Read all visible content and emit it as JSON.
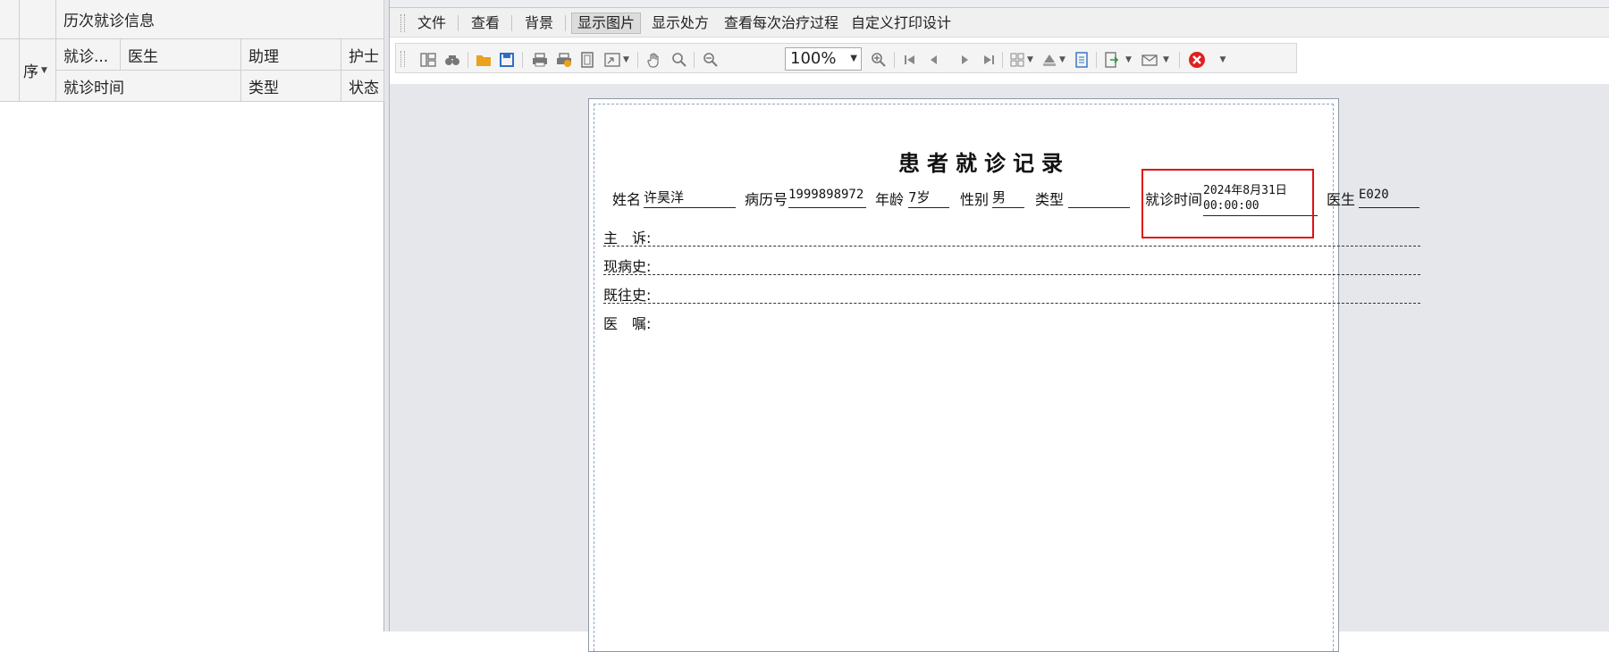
{
  "left_panel": {
    "group_header": "历次就诊信息",
    "columns_row1": [
      "就诊...",
      "医生",
      "助理",
      "护士"
    ],
    "columns_row2": [
      "就诊时间",
      "类型",
      "状态"
    ],
    "seq_column": "序",
    "seq_filter_icon": "dropdown-arrow"
  },
  "menu": {
    "items": [
      "文件",
      "查看",
      "背景",
      "显示图片",
      "显示处方",
      "查看每次治疗过程",
      "自定义打印设计"
    ],
    "active_item": "显示图片"
  },
  "toolbar": {
    "zoom_value": "100%",
    "icons": [
      "toc-icon",
      "find-icon",
      "open-icon",
      "save-icon",
      "print-icon",
      "quick-print-icon",
      "page-setup-icon",
      "scale-icon",
      "hand-tool-icon",
      "magnifier-icon",
      "zoom-out-icon",
      "zoom-in-icon",
      "first-page-icon",
      "previous-page-icon",
      "next-page-icon",
      "last-page-icon",
      "multiple-pages-icon",
      "color-icon",
      "watermark-icon",
      "export-icon",
      "send-icon",
      "close-preview-icon"
    ]
  },
  "report": {
    "title": "患者就诊记录",
    "name_label": "姓名",
    "name_value": "许昊洋",
    "record_no_label": "病历号",
    "record_no_value": "1999898972",
    "age_label": "年龄",
    "age_value": "7岁",
    "sex_label": "性别",
    "sex_value": "男",
    "type_label": "类型",
    "type_value": "",
    "visit_time_label": "就诊时间",
    "visit_time_date": "2024年8月31日",
    "visit_time_clock": "00:00:00",
    "doctor_label": "医生",
    "doctor_value": "E020",
    "sections": [
      "主　诉:",
      "现病史:",
      "既往史:",
      "医　嘱:"
    ]
  },
  "colors": {
    "highlight_border": "#e01010",
    "page_border": "#8f98a8",
    "close_icon_red": "#e02020",
    "open_icon_orange": "#e8a21c",
    "save_icon_blue": "#2f6fc0"
  }
}
